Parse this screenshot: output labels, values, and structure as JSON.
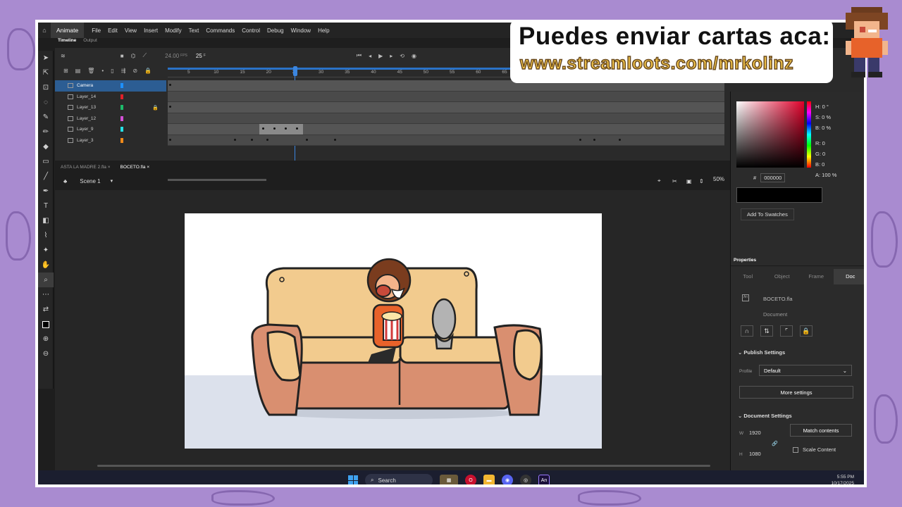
{
  "menu": {
    "app_name": "Animate",
    "items": [
      "File",
      "Edit",
      "View",
      "Insert",
      "Modify",
      "Text",
      "Commands",
      "Control",
      "Debug",
      "Window",
      "Help"
    ]
  },
  "timeline_tabs": [
    "Timeline",
    "Output"
  ],
  "timeline": {
    "fps": "24.00",
    "fps_unit": "FPS",
    "frame": "25",
    "frame_unit": "F",
    "ruler_ticks": [
      "5",
      "10",
      "15",
      "20",
      "25",
      "30",
      "35",
      "40",
      "45",
      "50",
      "55",
      "60",
      "65"
    ],
    "layers": [
      {
        "name": "Camera",
        "color": "#1e90ff",
        "locked": false
      },
      {
        "name": "Layer_14",
        "color": "#e0202a",
        "locked": false
      },
      {
        "name": "Layer_13",
        "color": "#1dbb6b",
        "locked": true
      },
      {
        "name": "Layer_12",
        "color": "#d44fd6",
        "locked": false
      },
      {
        "name": "Layer_9",
        "color": "#25e0e6",
        "locked": false
      },
      {
        "name": "Layer_3",
        "color": "#f08a1a",
        "locked": false
      }
    ]
  },
  "doc_tabs": [
    "ASTA LA MADRE 2.fla",
    "BOCETO.fla"
  ],
  "scene": {
    "label": "Scene 1",
    "zoom": "50%"
  },
  "color_panel": {
    "h": "H: 0 °",
    "s": "S: 0 %",
    "b": "B: 0 %",
    "r": "R: 0",
    "g": "G: 0",
    "bb": "B: 0",
    "a": "A: 100 %",
    "hex_label": "#",
    "hex": "000000",
    "add_swatches": "Add To Swatches"
  },
  "properties": {
    "header": "Properties",
    "tabs": [
      "Tool",
      "Object",
      "Frame",
      "Doc"
    ],
    "doc_name": "BOCETO.fla",
    "doc_type": "Document",
    "publish_settings": "Publish Settings",
    "profile_label": "Profile",
    "profile_value": "Default",
    "more_settings": "More settings",
    "document_settings": "Document Settings",
    "w_label": "W",
    "w_value": "1920",
    "h_label": "H",
    "h_value": "1080",
    "match_contents": "Match contents",
    "scale_content": "Scale Content"
  },
  "taskbar": {
    "search": "Search",
    "time": "5:55 PM",
    "date": "10/17/2025"
  },
  "overlay": {
    "line1": "Puedes enviar cartas aca:",
    "line2": "www.streamloots.com/mrkolinz"
  },
  "colors": {
    "accent": "#2c5d93",
    "playhead": "#3b86e0",
    "frame_bg": "#a98bd0"
  }
}
